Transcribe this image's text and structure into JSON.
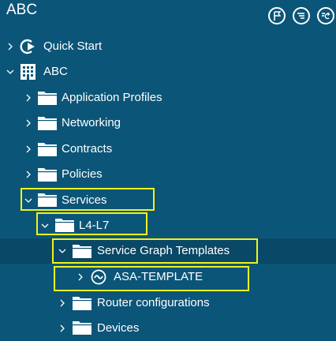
{
  "window": {
    "title": "ABC"
  },
  "toolbar": {
    "buttons": [
      {
        "icon": "flag-icon"
      },
      {
        "icon": "list-menu-icon"
      },
      {
        "icon": "refresh-icon"
      }
    ]
  },
  "tree": {
    "items": [
      {
        "label": "Quick Start",
        "icon": "quick-start-icon",
        "expanded": false
      },
      {
        "label": "ABC",
        "icon": "building-icon",
        "expanded": true
      },
      {
        "label": "Application Profiles",
        "icon": "folder-icon",
        "expanded": false
      },
      {
        "label": "Networking",
        "icon": "folder-icon",
        "expanded": false
      },
      {
        "label": "Contracts",
        "icon": "folder-icon",
        "expanded": false
      },
      {
        "label": "Policies",
        "icon": "folder-icon",
        "expanded": false
      },
      {
        "label": "Services",
        "icon": "folder-icon",
        "expanded": true
      },
      {
        "label": "L4-L7",
        "icon": "folder-icon",
        "expanded": true
      },
      {
        "label": "Service Graph Templates",
        "icon": "folder-icon",
        "expanded": true,
        "selected": true
      },
      {
        "label": "ASA-TEMPLATE",
        "icon": "template-icon",
        "expanded": false
      },
      {
        "label": "Router configurations",
        "icon": "folder-icon",
        "expanded": false
      },
      {
        "label": "Devices",
        "icon": "folder-icon",
        "expanded": false
      }
    ]
  },
  "colors": {
    "background": "#0b5578",
    "selected_row": "#094866",
    "highlight": "#f2f21a"
  }
}
